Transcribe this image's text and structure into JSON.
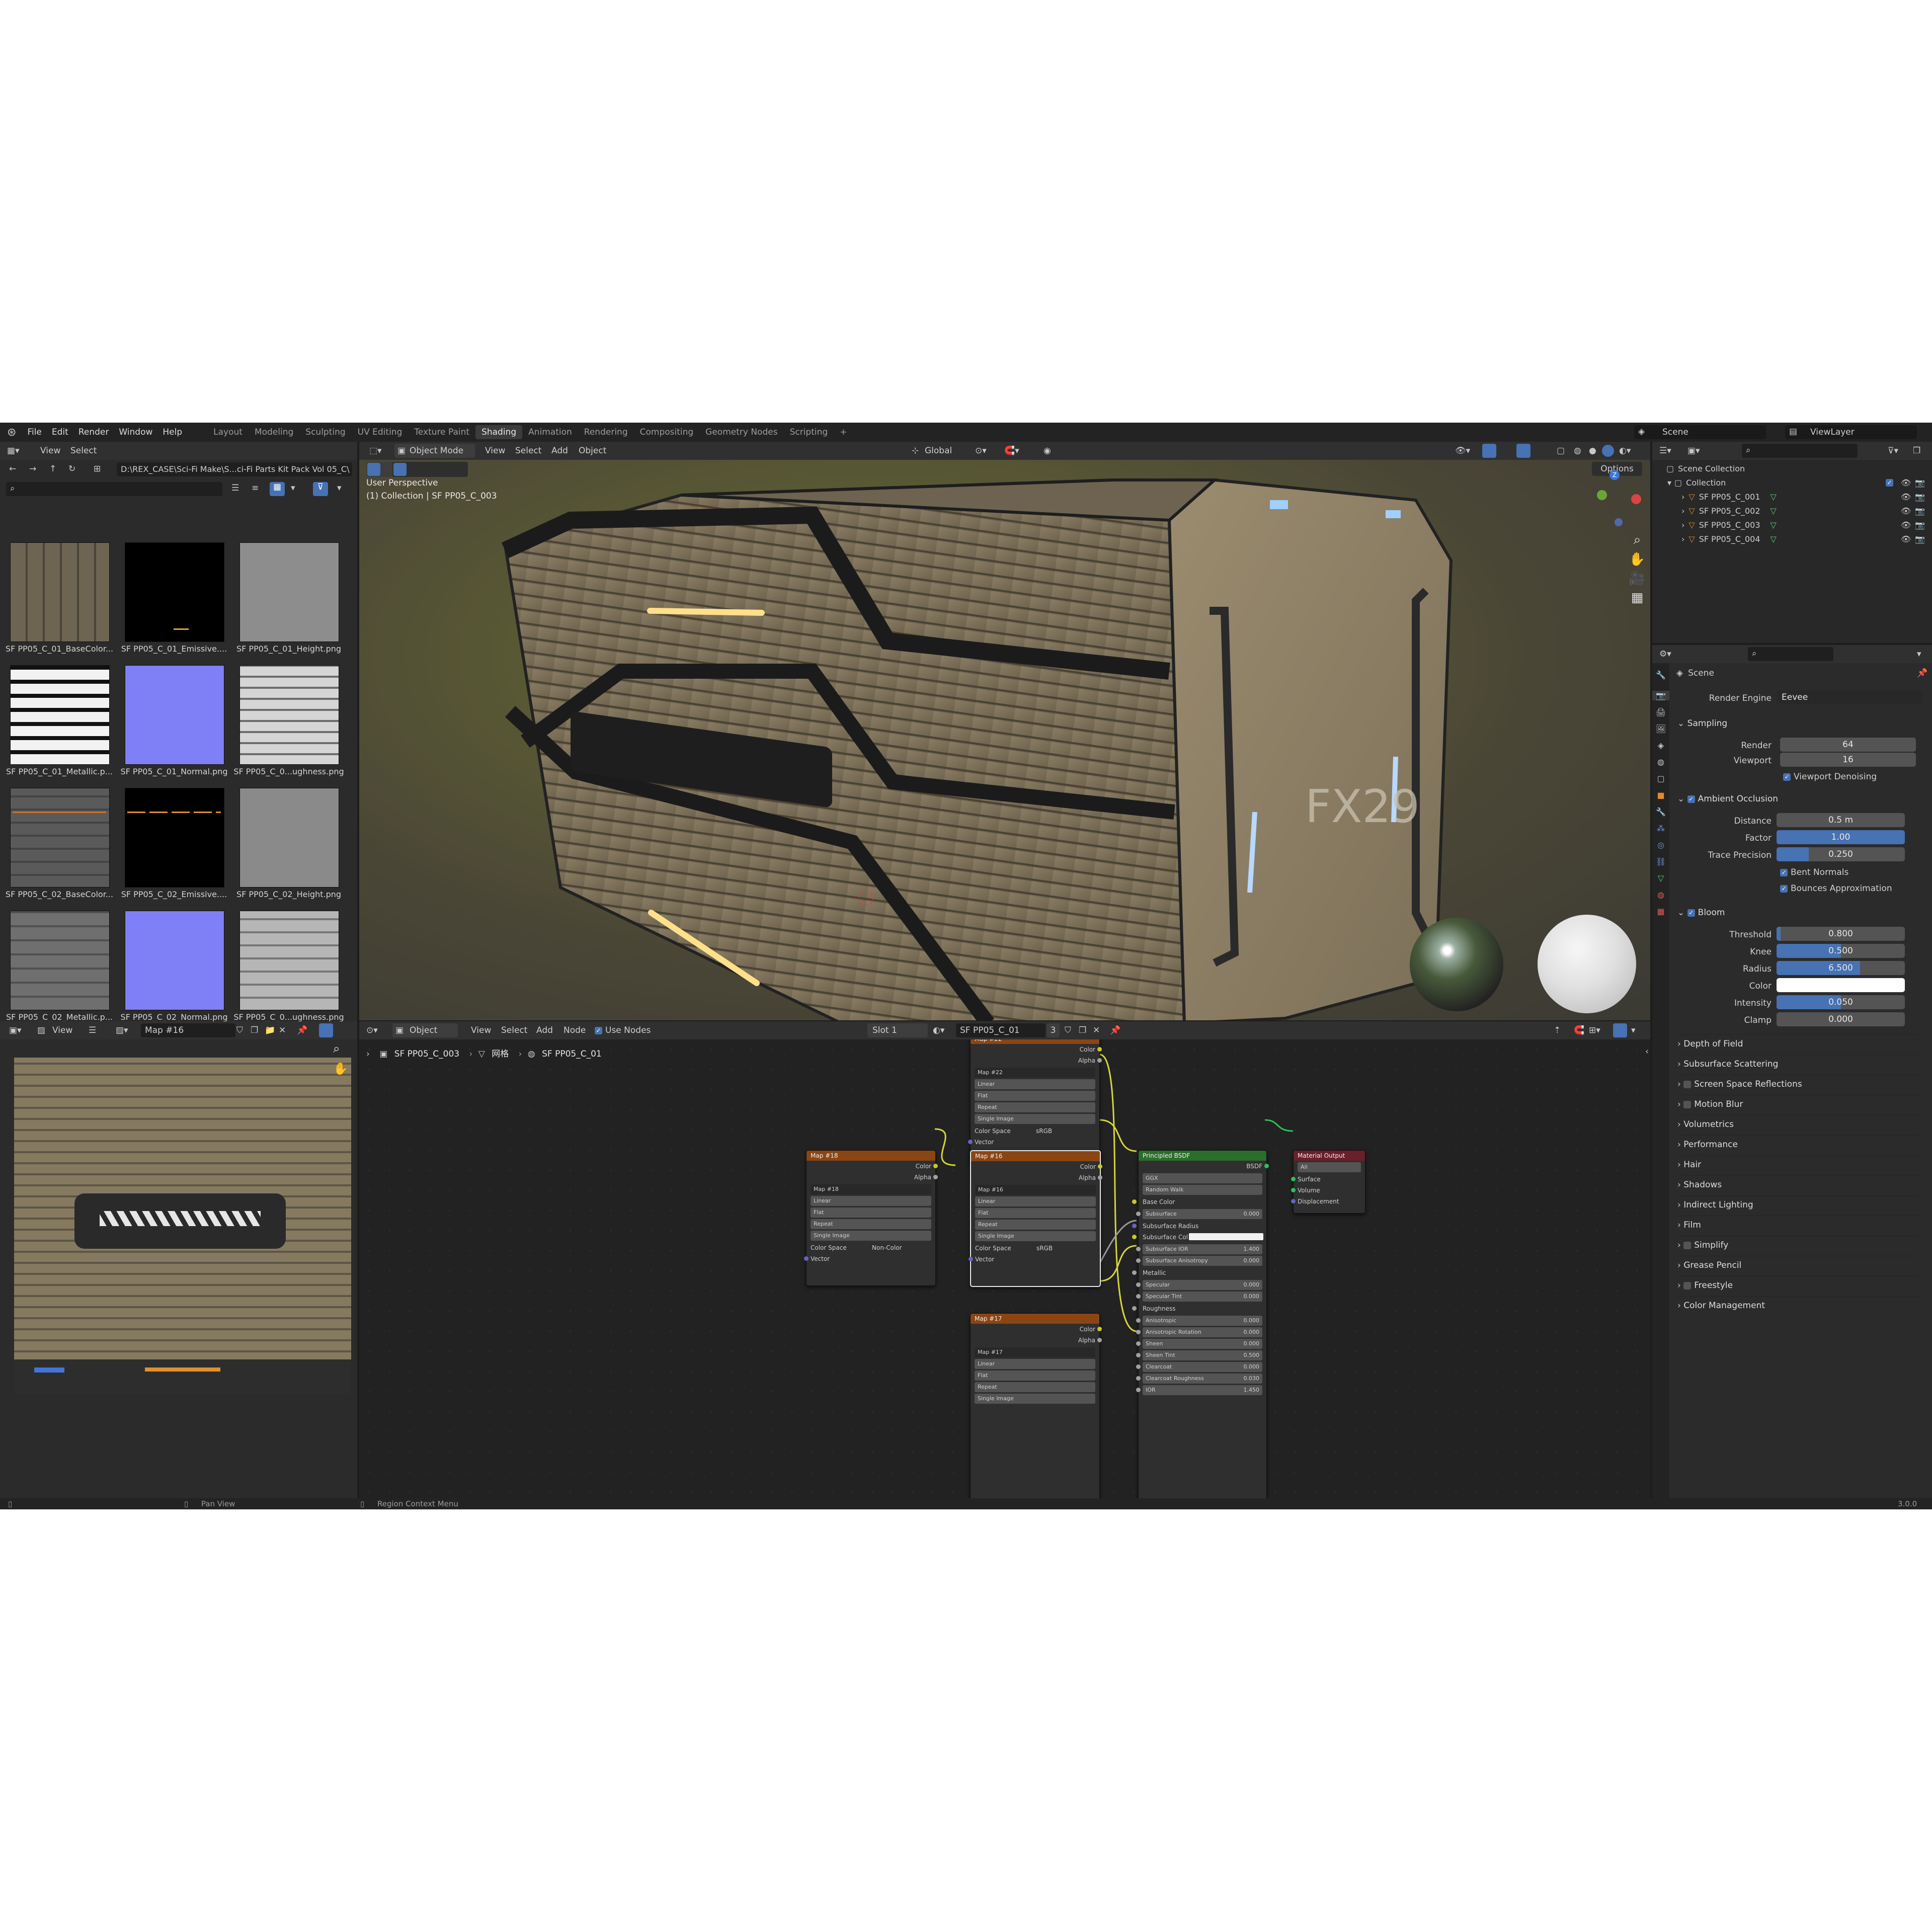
{
  "topbar": {
    "menus": [
      "File",
      "Edit",
      "Render",
      "Window",
      "Help"
    ],
    "workspaces": [
      "Layout",
      "Modeling",
      "Sculpting",
      "UV Editing",
      "Texture Paint",
      "Shading",
      "Animation",
      "Rendering",
      "Compositing",
      "Geometry Nodes",
      "Scripting"
    ],
    "active_workspace": "Shading",
    "scene": "Scene",
    "view_layer": "ViewLayer"
  },
  "file_browser": {
    "menus": [
      "View",
      "Select"
    ],
    "path": "D:\\REX_CASE\\Sci-Fi Make\\S...ci-Fi Parts Kit Pack Vol 05_C\\",
    "files": [
      "SF PP05_C_01_BaseColor...",
      "SF PP05_C_01_Emissive....",
      "SF PP05_C_01_Height.png",
      "SF PP05_C_01_Metallic.p...",
      "SF PP05_C_01_Normal.png",
      "SF PP05_C_0...ughness.png",
      "SF PP05_C_02_BaseColor...",
      "SF PP05_C_02_Emissive....",
      "SF PP05_C_02_Height.png",
      "SF PP05_C_02_Metallic.p...",
      "SF PP05_C_02_Normal.png",
      "SF PP05_C_0...ughness.png"
    ]
  },
  "viewport": {
    "mode": "Object Mode",
    "menus": [
      "View",
      "Select",
      "Add",
      "Object"
    ],
    "transform": "Global",
    "options": "Options",
    "title": "User Perspective",
    "subtitle": "(1) Collection | SF PP05_C_003",
    "decal_text": "FX29"
  },
  "image_editor": {
    "menus": [
      "View"
    ],
    "image_name": "Map #16"
  },
  "node_editor": {
    "type": "Object",
    "menus": [
      "View",
      "Select",
      "Add",
      "Node"
    ],
    "use_nodes": "Use Nodes",
    "slot": "Slot 1",
    "material": "SF PP05_C_01",
    "users": "3",
    "breadcrumb": [
      "SF PP05_C_003",
      "网格",
      "SF PP05_C_01"
    ],
    "image_nodes": [
      {
        "title": "Map #22",
        "image": "Map #22",
        "interp": "Linear",
        "proj": "Flat",
        "ext": "Repeat",
        "src": "Single Image",
        "cs_label": "Color Space",
        "cs": "sRGB"
      },
      {
        "title": "Map #18",
        "image": "Map #18",
        "interp": "Linear",
        "proj": "Flat",
        "ext": "Repeat",
        "src": "Single Image",
        "cs_label": "Color Space",
        "cs": "Non-Color"
      },
      {
        "title": "Map #16",
        "image": "Map #16",
        "interp": "Linear",
        "proj": "Flat",
        "ext": "Repeat",
        "src": "Single Image",
        "cs_label": "Color Space",
        "cs": "sRGB"
      },
      {
        "title": "Map #17",
        "image": "Map #17",
        "interp": "Linear",
        "proj": "Flat",
        "ext": "Repeat",
        "src": "Single Image",
        "cs_label": "Color Space",
        "cs": "sRGB"
      }
    ],
    "socket_labels": {
      "color": "Color",
      "alpha": "Alpha",
      "vector": "Vector"
    },
    "bsdf": {
      "title": "Principled BSDF",
      "out": "BSDF",
      "dist": "GGX",
      "sss": "Random Walk",
      "rows": [
        {
          "label": "Base Color",
          "value": ""
        },
        {
          "label": "Subsurface",
          "value": "0.000"
        },
        {
          "label": "Subsurface Radius",
          "value": ""
        },
        {
          "label": "Subsurface Col",
          "value": ""
        },
        {
          "label": "Subsurface IOR",
          "value": "1.400"
        },
        {
          "label": "Subsurface Anisotropy",
          "value": "0.000"
        },
        {
          "label": "Metallic",
          "value": ""
        },
        {
          "label": "Specular",
          "value": "0.000"
        },
        {
          "label": "Specular Tint",
          "value": "0.000"
        },
        {
          "label": "Roughness",
          "value": ""
        },
        {
          "label": "Anisotropic",
          "value": "0.000"
        },
        {
          "label": "Anisotropic Rotation",
          "value": "0.000"
        },
        {
          "label": "Sheen",
          "value": "0.000"
        },
        {
          "label": "Sheen Tint",
          "value": "0.500"
        },
        {
          "label": "Clearcoat",
          "value": "0.000"
        },
        {
          "label": "Clearcoat Roughness",
          "value": "0.030"
        },
        {
          "label": "IOR",
          "value": "1.450"
        }
      ]
    },
    "output": {
      "title": "Material Output",
      "target": "All",
      "inputs": [
        "Surface",
        "Volume",
        "Displacement"
      ]
    }
  },
  "outliner": {
    "root": "Scene Collection",
    "collection": "Collection",
    "objects": [
      "SF PP05_C_001",
      "SF PP05_C_002",
      "SF PP05_C_003",
      "SF PP05_C_004"
    ]
  },
  "properties": {
    "context": "Scene",
    "render_engine_label": "Render Engine",
    "render_engine": "Eevee",
    "sampling": {
      "title": "Sampling",
      "render_label": "Render",
      "render": "64",
      "viewport_label": "Viewport",
      "viewport": "16",
      "denoise": "Viewport Denoising"
    },
    "ao": {
      "title": "Ambient Occlusion",
      "distance_label": "Distance",
      "distance": "0.5 m",
      "factor_label": "Factor",
      "factor": "1.00",
      "trace_label": "Trace Precision",
      "trace": "0.250",
      "bent": "Bent Normals",
      "bounces": "Bounces Approximation"
    },
    "bloom": {
      "title": "Bloom",
      "threshold_label": "Threshold",
      "threshold": "0.800",
      "knee_label": "Knee",
      "knee": "0.500",
      "radius_label": "Radius",
      "radius": "6.500",
      "color_label": "Color",
      "intensity_label": "Intensity",
      "intensity": "0.050",
      "clamp_label": "Clamp",
      "clamp": "0.000"
    },
    "panels": [
      "Depth of Field",
      "Subsurface Scattering",
      "Screen Space Reflections",
      "Motion Blur",
      "Volumetrics",
      "Performance",
      "Hair",
      "Shadows",
      "Indirect Lighting",
      "Film",
      "Simplify",
      "Grease Pencil",
      "Freestyle",
      "Color Management"
    ]
  },
  "statusbar": {
    "pan": "Pan View",
    "context": "Region Context Menu",
    "version": "3.0.0"
  },
  "colors": {
    "accent": "#4772b3",
    "node_image": "#8b4513",
    "node_shader": "#2b6e2b",
    "node_output": "#6b1f2b"
  }
}
